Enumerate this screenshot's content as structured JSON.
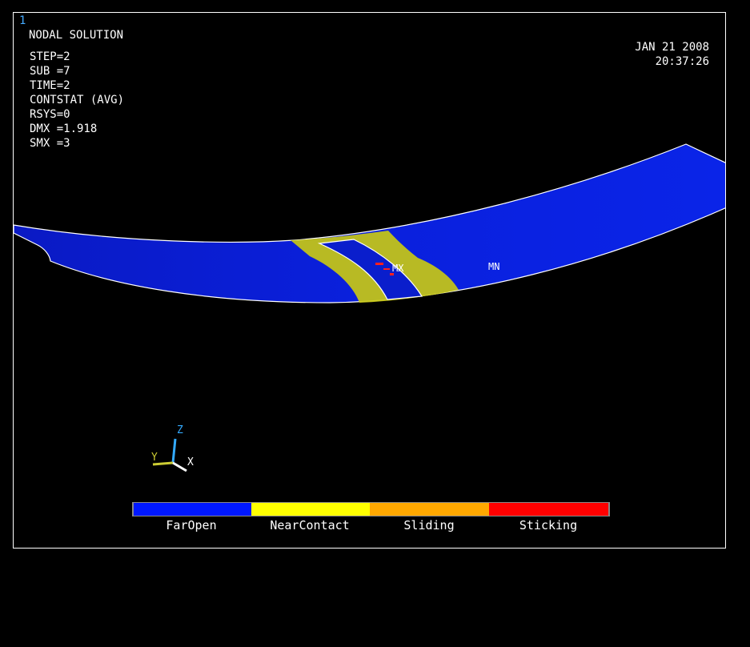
{
  "window": {
    "number": "1"
  },
  "header": {
    "title": "NODAL SOLUTION",
    "info": [
      "STEP=2",
      "SUB =7",
      "TIME=2",
      "CONTSTAT (AVG)",
      "RSYS=0",
      "DMX =1.918",
      "SMX =3"
    ],
    "date": "JAN 21 2008",
    "time": "20:37:26"
  },
  "markers": {
    "max": "MX",
    "min": "MN"
  },
  "triad": {
    "x": "X",
    "y": "Y",
    "z": "Z"
  },
  "legend": {
    "items": [
      {
        "label": "FarOpen",
        "color": "#0018ff"
      },
      {
        "label": "NearContact",
        "color": "#ffff00"
      },
      {
        "label": "Sliding",
        "color": "#ffa800"
      },
      {
        "label": "Sticking",
        "color": "#ff0000"
      }
    ]
  },
  "colors": {
    "model_blue": "#0a1ecc",
    "contact_yellow": "#c8c814",
    "frame": "#ffffff",
    "window_number": "#44aaff"
  }
}
